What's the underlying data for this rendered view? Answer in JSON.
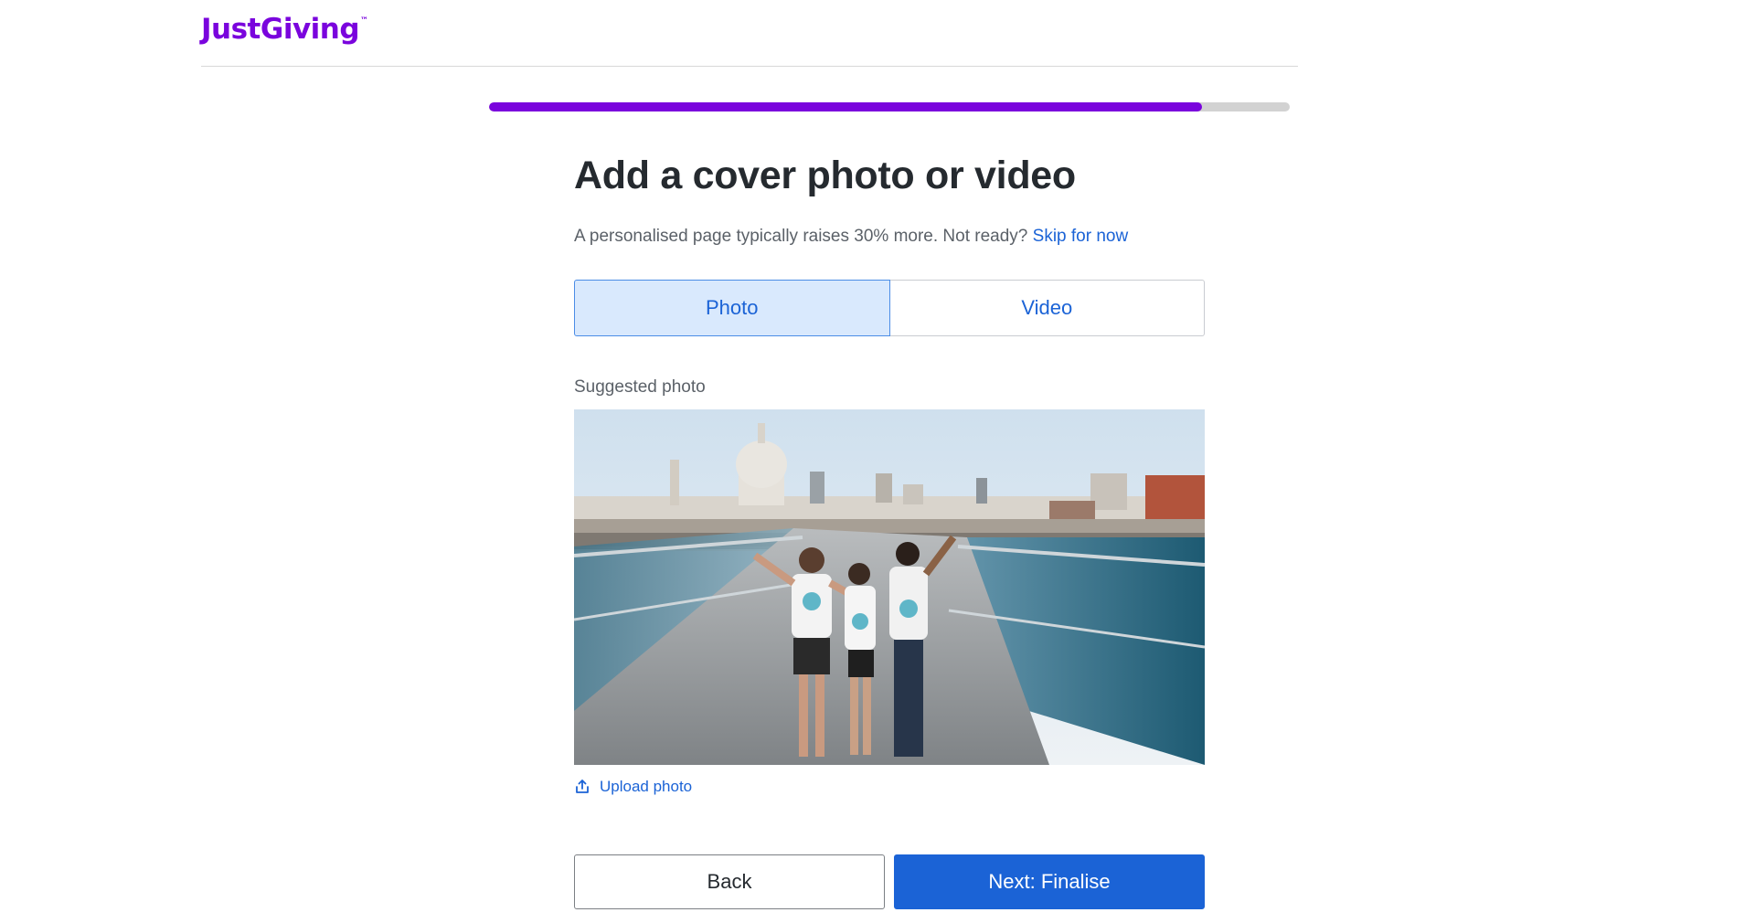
{
  "header": {
    "logo_text": "JustGiving",
    "logo_mark": "™"
  },
  "progress": {
    "value_percent": 89
  },
  "main": {
    "title": "Add a cover photo or video",
    "subtitle": "A personalised page typically raises 30% more. Not ready?",
    "skip_link": "Skip for now",
    "tabs": [
      {
        "label": "Photo",
        "active": true
      },
      {
        "label": "Video",
        "active": false
      }
    ],
    "suggested_label": "Suggested photo",
    "upload_label": "Upload photo"
  },
  "actions": {
    "back_label": "Back",
    "next_label": "Next: Finalise"
  },
  "colors": {
    "brand": "#7a04dd",
    "link": "#1b63d6",
    "tab_active_bg": "#d9e9fd"
  },
  "icons": {
    "upload": "upload-icon"
  }
}
